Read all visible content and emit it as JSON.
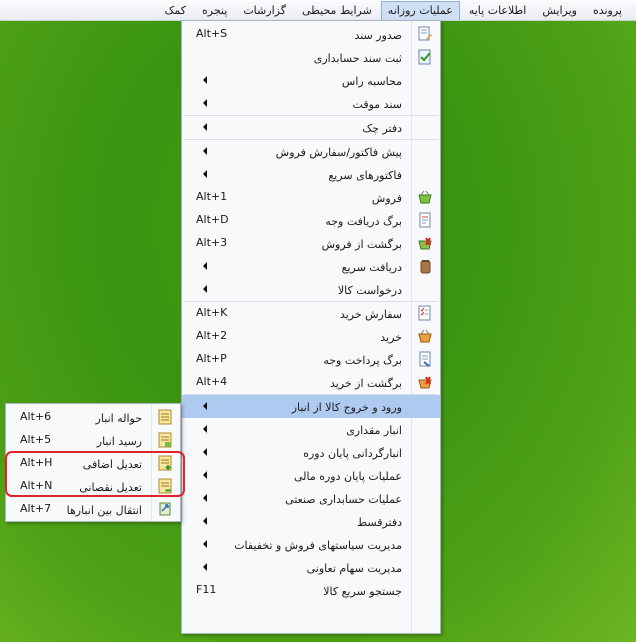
{
  "menubar": {
    "items": [
      {
        "label": "پرونده"
      },
      {
        "label": "ویرایش"
      },
      {
        "label": "اطلاعات پایه"
      },
      {
        "label": "عملیات روزانه",
        "active": true
      },
      {
        "label": "شرایط محیطی"
      },
      {
        "label": "گزارشات"
      },
      {
        "label": "پنجره"
      },
      {
        "label": "کمک"
      }
    ]
  },
  "main_menu": {
    "items": [
      {
        "type": "item",
        "label": "صدور سند",
        "shortcut": "Alt+S",
        "icon": "document-edit-icon"
      },
      {
        "type": "item",
        "label": "ثبت سند حسابداری",
        "icon": "document-check-icon"
      },
      {
        "type": "item",
        "label": "محاسبه راس",
        "submenu": true
      },
      {
        "type": "item",
        "label": "سند موقت",
        "submenu": true
      },
      {
        "type": "sep"
      },
      {
        "type": "item",
        "label": "دفتر چک",
        "submenu": true
      },
      {
        "type": "sep"
      },
      {
        "type": "item",
        "label": "پیش فاکتور/سفارش فروش",
        "submenu": true
      },
      {
        "type": "item",
        "label": "فاکتورهای سریع",
        "submenu": true
      },
      {
        "type": "item",
        "label": "فروش",
        "shortcut": "Alt+1",
        "icon": "basket-green-icon"
      },
      {
        "type": "item",
        "label": "برگ دریافت وجه",
        "shortcut": "Alt+D",
        "icon": "receipt-icon"
      },
      {
        "type": "item",
        "label": "برگشت از فروش",
        "shortcut": "Alt+3",
        "icon": "basket-return-icon"
      },
      {
        "type": "item",
        "label": "دریافت سریع",
        "submenu": true,
        "icon": "cash-jar-icon"
      },
      {
        "type": "item",
        "label": "درخواست کالا",
        "submenu": true
      },
      {
        "type": "sep"
      },
      {
        "type": "item",
        "label": "سفارش خرید",
        "shortcut": "Alt+K",
        "icon": "checklist-icon"
      },
      {
        "type": "item",
        "label": "خرید",
        "shortcut": "Alt+2",
        "icon": "basket-orange-icon"
      },
      {
        "type": "item",
        "label": "برگ پرداخت وجه",
        "shortcut": "Alt+P",
        "icon": "payment-slip-icon"
      },
      {
        "type": "item",
        "label": "برگشت از خرید",
        "shortcut": "Alt+4",
        "icon": "basket-red-icon"
      },
      {
        "type": "sep"
      },
      {
        "type": "item",
        "label": "ورود و خروج کالا از انبار",
        "submenu": true,
        "highlighted": true
      },
      {
        "type": "item",
        "label": "انبار مقداری",
        "submenu": true
      },
      {
        "type": "item",
        "label": "انبارگردانی پایان دوره",
        "submenu": true
      },
      {
        "type": "item",
        "label": "عملیات پایان دوره مالی",
        "submenu": true
      },
      {
        "type": "item",
        "label": "عملیات حسابداری صنعتی",
        "submenu": true
      },
      {
        "type": "item",
        "label": "دفترقسط",
        "submenu": true
      },
      {
        "type": "item",
        "label": "مدیریت سیاستهای فروش و تخفیفات",
        "submenu": true
      },
      {
        "type": "item",
        "label": "مدیریت سهام تعاونی",
        "submenu": true
      },
      {
        "type": "item",
        "label": "جستجو سریع کالا",
        "shortcut": "F11"
      }
    ]
  },
  "sub_menu": {
    "items": [
      {
        "label": "حواله انبار",
        "shortcut": "Alt+6",
        "icon": "form-icon"
      },
      {
        "label": "رسید انبار",
        "shortcut": "Alt+5",
        "icon": "form-receipt-icon"
      },
      {
        "label": "تعدیل اضافی",
        "shortcut": "Alt+H",
        "icon": "form-plus-icon"
      },
      {
        "label": "تعدیل نقصانی",
        "shortcut": "Alt+N",
        "icon": "form-minus-icon"
      },
      {
        "label": "انتقال بین انبارها",
        "shortcut": "Alt+7",
        "icon": "transfer-icon"
      }
    ]
  },
  "colors": {
    "background": "#3f9a12",
    "highlight": "#aecaf0",
    "annotation": "#e0242c"
  }
}
